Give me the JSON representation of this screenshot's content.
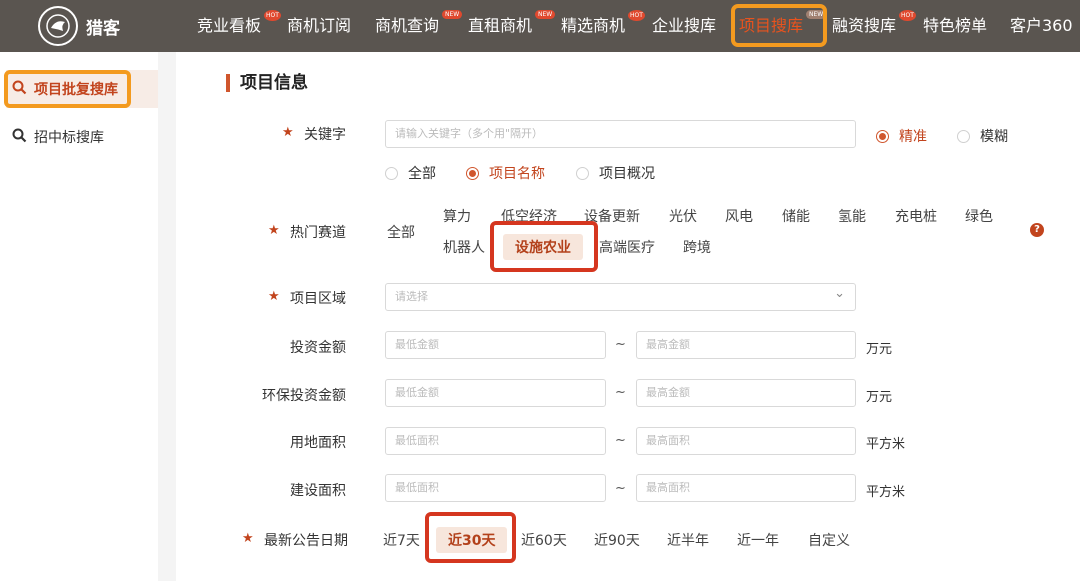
{
  "brand": {
    "name": "猎客"
  },
  "nav": {
    "items": [
      {
        "label": "竞业看板",
        "badge": "HOT"
      },
      {
        "label": "商机订阅",
        "badge": ""
      },
      {
        "label": "商机查询",
        "badge": "NEW"
      },
      {
        "label": "直租商机",
        "badge": "NEW"
      },
      {
        "label": "精选商机",
        "badge": "HOT"
      },
      {
        "label": "企业搜库",
        "badge": ""
      },
      {
        "label": "项目搜库",
        "badge": "NEW"
      },
      {
        "label": "融资搜库",
        "badge": "HOT"
      },
      {
        "label": "特色榜单",
        "badge": ""
      },
      {
        "label": "客户360",
        "badge": ""
      }
    ],
    "active_index": 6
  },
  "sidebar": {
    "items": [
      {
        "label": "项目批复搜库",
        "icon": "search-icon"
      },
      {
        "label": "招中标搜库",
        "icon": "search-icon"
      }
    ]
  },
  "form": {
    "section_title": "项目信息",
    "keyword": {
      "label": "关键字",
      "placeholder": "请输入关键字（多个用\"隔开）",
      "match_options": [
        "精准",
        "模糊"
      ],
      "match_selected": "精准",
      "scope_options": [
        "全部",
        "项目名称",
        "项目概况"
      ],
      "scope_selected": "项目名称"
    },
    "hot_track": {
      "label": "热门赛道",
      "all_label": "全部",
      "row1": [
        "算力",
        "低空经济",
        "设备更新",
        "光伏",
        "风电",
        "储能",
        "氢能",
        "充电桩",
        "绿色"
      ],
      "row2": [
        "机器人",
        "设施农业",
        "高端医疗",
        "跨境"
      ],
      "selected": "设施农业",
      "help": "?"
    },
    "region": {
      "label": "项目区域",
      "placeholder": "请选择"
    },
    "investment": {
      "label": "投资金额",
      "min_placeholder": "最低金额",
      "max_placeholder": "最高金额",
      "unit": "万元"
    },
    "env_investment": {
      "label": "环保投资金额",
      "min_placeholder": "最低金额",
      "max_placeholder": "最高金额",
      "unit": "万元"
    },
    "land_area": {
      "label": "用地面积",
      "min_placeholder": "最低面积",
      "max_placeholder": "最高面积",
      "unit": "平方米"
    },
    "build_area": {
      "label": "建设面积",
      "min_placeholder": "最低面积",
      "max_placeholder": "最高面积",
      "unit": "平方米"
    },
    "date": {
      "label": "最新公告日期",
      "options": [
        "近7天",
        "近30天",
        "近60天",
        "近90天",
        "近半年",
        "近一年",
        "自定义"
      ],
      "selected": "近30天"
    },
    "tilde": "~"
  },
  "colors": {
    "accent": "#d0562d",
    "highlight_orange": "#f39a1f",
    "highlight_red": "#d5361f",
    "topbar": "#5a5550"
  }
}
